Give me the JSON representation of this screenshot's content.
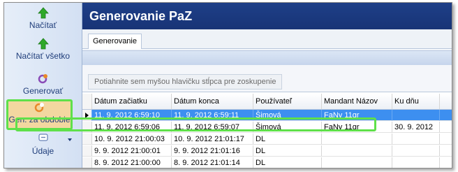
{
  "sidebar": {
    "load_label": "Načítať",
    "load_all_label": "Načítať všetko",
    "generate_label": "Generovať",
    "gen_period_label": "Gen. za obdobie",
    "data_label": "Údaje"
  },
  "header": {
    "title": "Generovanie PaZ"
  },
  "tabs": {
    "active_label": "Generovanie"
  },
  "group_panel": {
    "hint": "Potiahnite sem myšou hlavičku stĺpca pre zoskupenie"
  },
  "grid": {
    "columns": [
      "Dátum začiatku",
      "Dátum konca",
      "Používateľ",
      "Mandant Názov",
      "Ku dňu"
    ],
    "rows": [
      {
        "start": "11. 9. 2012 6:59:10",
        "end": "11. 9. 2012 6:59:11",
        "user": "Šimová",
        "mandant": "FaNy 11gr",
        "ku_dnu": ""
      },
      {
        "start": "11. 9. 2012 6:59:06",
        "end": "11. 9. 2012 6:59:07",
        "user": "Šimová",
        "mandant": "FaNy 11gr",
        "ku_dnu": "30. 9. 2012"
      },
      {
        "start": "10. 9. 2012 21:00:03",
        "end": "10. 9. 2012 21:01:17",
        "user": "DL",
        "mandant": "",
        "ku_dnu": ""
      },
      {
        "start": "9. 9. 2012 21:00:01",
        "end": "9. 9. 2012 21:01:16",
        "user": "DL",
        "mandant": "",
        "ku_dnu": ""
      },
      {
        "start": "8. 9. 2012 21:00:00",
        "end": "8. 9. 2012 21:01:14",
        "user": "DL",
        "mandant": "",
        "ku_dnu": ""
      }
    ]
  },
  "colors": {
    "header_bg": "#1e3f88",
    "highlight": "#5fe04a",
    "selected_row": "#3d8ff0",
    "accent_orange": "#e8892a"
  },
  "icons": {
    "load": "arrow-up-green-icon",
    "load_all": "arrow-up-green-icon",
    "generate": "generate-gear-icon",
    "gen_period": "generate-gear-icon",
    "data": "data-dropdown-icon"
  }
}
